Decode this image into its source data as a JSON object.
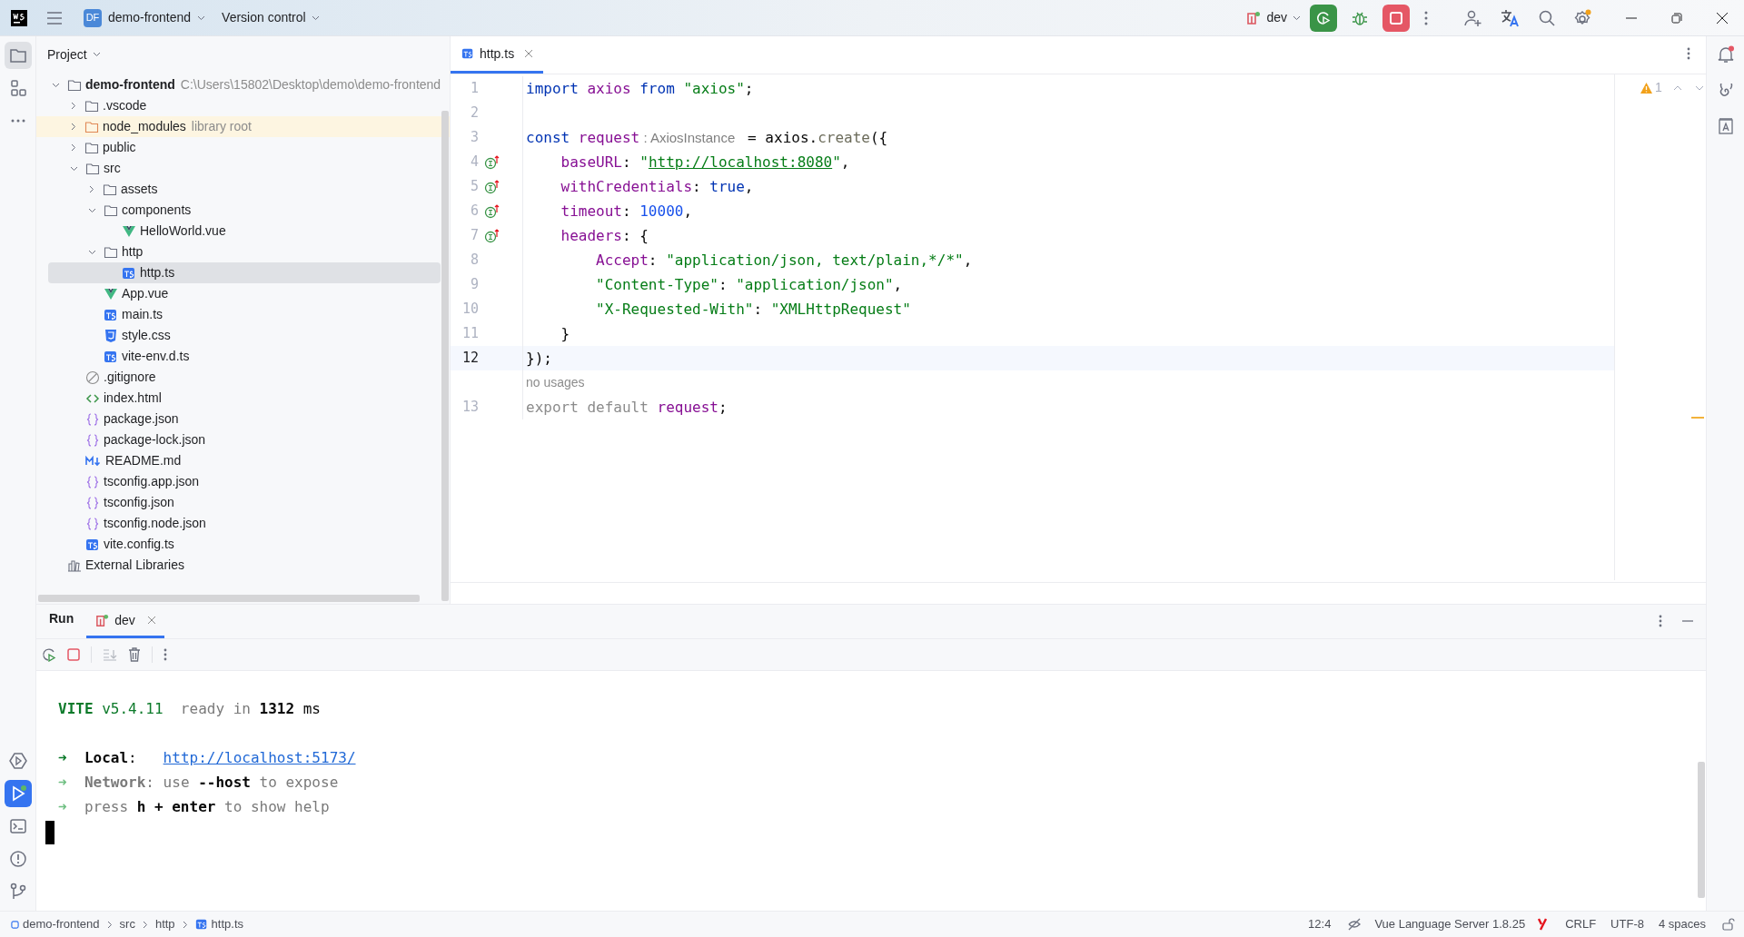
{
  "title_bar": {
    "project_badge": "DF",
    "project": "demo-frontend",
    "vcs": "Version control",
    "run_config": "dev"
  },
  "left_toolbar": {
    "top": [
      {
        "kind": "project",
        "selected": true
      },
      {
        "kind": "structure",
        "selected": false
      },
      {
        "kind": "more",
        "selected": false
      }
    ],
    "bottom": [
      {
        "kind": "services",
        "selected": false
      },
      {
        "kind": "run",
        "selected": true
      },
      {
        "kind": "terminal",
        "selected": false
      },
      {
        "kind": "problems",
        "selected": false
      },
      {
        "kind": "git",
        "selected": false
      }
    ]
  },
  "project_panel": {
    "title": "Project",
    "tree": [
      {
        "label": "demo-frontend",
        "hint": "C:\\Users\\15802\\Desktop\\demo\\demo-frontend",
        "kind": "folder",
        "expanded": true,
        "selected": false,
        "children": [
          {
            "label": ".vscode",
            "kind": "folder",
            "expanded": false,
            "selected": false
          },
          {
            "label": "node_modules",
            "hint": "library root",
            "kind": "library-folder",
            "expanded": false,
            "selected": false
          },
          {
            "label": "public",
            "kind": "folder",
            "expanded": false,
            "selected": false
          },
          {
            "label": "src",
            "kind": "folder",
            "expanded": true,
            "selected": false,
            "children": [
              {
                "label": "assets",
                "kind": "folder",
                "expanded": false,
                "selected": false
              },
              {
                "label": "components",
                "kind": "folder",
                "expanded": true,
                "selected": false,
                "children": [
                  {
                    "label": "HelloWorld.vue",
                    "kind": "vue",
                    "selected": false
                  }
                ]
              },
              {
                "label": "http",
                "kind": "folder",
                "expanded": true,
                "selected": false,
                "children": [
                  {
                    "label": "http.ts",
                    "kind": "ts",
                    "selected": true
                  }
                ]
              },
              {
                "label": "App.vue",
                "kind": "vue",
                "selected": false
              },
              {
                "label": "main.ts",
                "kind": "ts",
                "selected": false
              },
              {
                "label": "style.css",
                "kind": "css",
                "selected": false
              },
              {
                "label": "vite-env.d.ts",
                "kind": "ts",
                "selected": false
              }
            ]
          },
          {
            "label": ".gitignore",
            "kind": "ignore",
            "selected": false
          },
          {
            "label": "index.html",
            "kind": "html",
            "selected": false
          },
          {
            "label": "package.json",
            "kind": "json",
            "selected": false
          },
          {
            "label": "package-lock.json",
            "kind": "json",
            "selected": false
          },
          {
            "label": "README.md",
            "kind": "md",
            "selected": false
          },
          {
            "label": "tsconfig.app.json",
            "kind": "json",
            "selected": false
          },
          {
            "label": "tsconfig.json",
            "kind": "json",
            "selected": false
          },
          {
            "label": "tsconfig.node.json",
            "kind": "json",
            "selected": false
          },
          {
            "label": "vite.config.ts",
            "kind": "ts",
            "selected": false
          }
        ]
      },
      {
        "label": "External Libraries",
        "kind": "library",
        "selected": false
      }
    ]
  },
  "editor": {
    "tabs": [
      {
        "label": "http.ts",
        "selected": true
      }
    ],
    "warning_count": "1",
    "lines": [
      {
        "number": "1",
        "current": false,
        "marker": false,
        "tokens": [
          {
            "kind": "keyword",
            "text": "import "
          },
          {
            "kind": "name",
            "text": "axios "
          },
          {
            "kind": "keyword",
            "text": "from "
          },
          {
            "kind": "string",
            "text": "\"axios\""
          },
          {
            "kind": "plain",
            "text": ";"
          }
        ]
      },
      {
        "number": "2",
        "current": false,
        "marker": false
      },
      {
        "number": "3",
        "current": false,
        "marker": false,
        "tokens": [
          {
            "kind": "keyword",
            "text": "const "
          },
          {
            "kind": "name",
            "text": "request"
          },
          {
            "kind": "hint",
            "text": " : AxiosInstance "
          },
          {
            "kind": "plain",
            "text": " = axios."
          },
          {
            "kind": "call",
            "text": "create"
          },
          {
            "kind": "plain",
            "text": "({"
          }
        ]
      },
      {
        "number": "4",
        "current": false,
        "marker": true,
        "tokens": [
          {
            "kind": "name",
            "text": "    baseURL"
          },
          {
            "kind": "plain",
            "text": ": "
          },
          {
            "kind": "string",
            "text": "\""
          },
          {
            "kind": "link",
            "text": "http://localhost:8080"
          },
          {
            "kind": "string",
            "text": "\""
          },
          {
            "kind": "plain",
            "text": ","
          }
        ]
      },
      {
        "number": "5",
        "current": false,
        "marker": true,
        "tokens": [
          {
            "kind": "name",
            "text": "    withCredentials"
          },
          {
            "kind": "plain",
            "text": ": "
          },
          {
            "kind": "keyword",
            "text": "true"
          },
          {
            "kind": "plain",
            "text": ","
          }
        ]
      },
      {
        "number": "6",
        "current": false,
        "marker": true,
        "tokens": [
          {
            "kind": "name",
            "text": "    timeout"
          },
          {
            "kind": "plain",
            "text": ": "
          },
          {
            "kind": "number",
            "text": "10000"
          },
          {
            "kind": "plain",
            "text": ","
          }
        ]
      },
      {
        "number": "7",
        "current": false,
        "marker": true,
        "tokens": [
          {
            "kind": "name",
            "text": "    headers"
          },
          {
            "kind": "plain",
            "text": ": {"
          }
        ]
      },
      {
        "number": "8",
        "current": false,
        "marker": false,
        "tokens": [
          {
            "kind": "name",
            "text": "        Accept"
          },
          {
            "kind": "plain",
            "text": ": "
          },
          {
            "kind": "string",
            "text": "\"application/json, text/plain,*/*\""
          },
          {
            "kind": "plain",
            "text": ","
          }
        ]
      },
      {
        "number": "9",
        "current": false,
        "marker": false,
        "tokens": [
          {
            "kind": "string",
            "text": "        \"Content-Type\""
          },
          {
            "kind": "plain",
            "text": ": "
          },
          {
            "kind": "string",
            "text": "\"application/json\""
          },
          {
            "kind": "plain",
            "text": ","
          }
        ]
      },
      {
        "number": "10",
        "current": false,
        "marker": false,
        "tokens": [
          {
            "kind": "string",
            "text": "        \"X-Requested-With\""
          },
          {
            "kind": "plain",
            "text": ": "
          },
          {
            "kind": "string",
            "text": "\"XMLHttpRequest\""
          }
        ]
      },
      {
        "number": "11",
        "current": false,
        "marker": false,
        "tokens": [
          {
            "kind": "plain",
            "text": "    }"
          }
        ]
      },
      {
        "number": "12",
        "current": true,
        "marker": false,
        "tokens": [
          {
            "kind": "plain",
            "text": "});"
          }
        ]
      },
      {
        "inlay": "no usages"
      },
      {
        "number": "13",
        "current": false,
        "marker": false,
        "tokens": [
          {
            "kind": "dim",
            "text": "export default "
          },
          {
            "kind": "name",
            "text": "request"
          },
          {
            "kind": "plain",
            "text": ";"
          }
        ]
      }
    ]
  },
  "run_panel": {
    "title": "Run",
    "tabs": [
      {
        "label": "dev",
        "selected": true
      }
    ],
    "cursor": true,
    "console": [
      {
        "tokens": [
          {
            "kind": "green-bold",
            "text": "VITE"
          },
          {
            "kind": "green",
            "text": " v5.4.11"
          },
          {
            "kind": "dim",
            "text": "  ready in "
          },
          {
            "kind": "bold",
            "text": "1312"
          },
          {
            "kind": "plain",
            "text": " ms"
          }
        ]
      },
      {
        "tokens": [
          {
            "kind": "arrow",
            "text": "➜  "
          },
          {
            "kind": "bold",
            "text": "Local"
          },
          {
            "kind": "plain",
            "text": ":   "
          },
          {
            "kind": "link",
            "text": "http://localhost:5173/"
          }
        ]
      },
      {
        "tokens": [
          {
            "kind": "arrow-dim",
            "text": "➜  "
          },
          {
            "kind": "dim-bold",
            "text": "Network"
          },
          {
            "kind": "dim",
            "text": ": use "
          },
          {
            "kind": "bold",
            "text": "--host"
          },
          {
            "kind": "dim",
            "text": " to expose"
          }
        ]
      },
      {
        "tokens": [
          {
            "kind": "arrow-dim",
            "text": "➜  "
          },
          {
            "kind": "dim",
            "text": "press "
          },
          {
            "kind": "bold",
            "text": "h + enter"
          },
          {
            "kind": "dim",
            "text": " to show help"
          }
        ]
      }
    ]
  },
  "status_bar": {
    "breadcrumbs": [
      {
        "label": "demo-frontend",
        "kind": "module"
      },
      {
        "label": "src",
        "kind": "folder"
      },
      {
        "label": "http",
        "kind": "folder"
      },
      {
        "label": "http.ts",
        "kind": "ts"
      }
    ],
    "position": "12:4",
    "language_server": "Vue Language Server 1.8.25",
    "line_separator": "CRLF",
    "encoding": "UTF-8",
    "indent": "4 spaces"
  }
}
